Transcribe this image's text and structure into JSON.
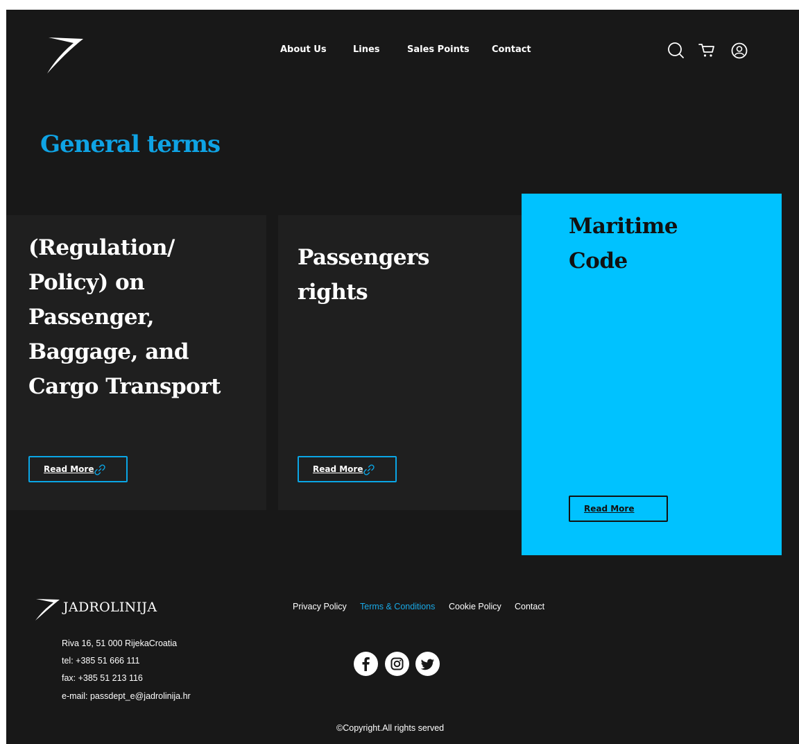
{
  "nav": {
    "items": [
      {
        "label": "About Us"
      },
      {
        "label": "Lines"
      },
      {
        "label": "Sales Points"
      },
      {
        "label": "Contact"
      }
    ],
    "icons": [
      "search-icon",
      "cart-icon",
      "user-icon"
    ]
  },
  "page": {
    "title": "General terms"
  },
  "cards": [
    {
      "title_lines": [
        "(Regulation/",
        "Policy) on",
        "Passenger,",
        "Baggage, and",
        "Cargo Transport"
      ],
      "button": "Read More",
      "icon": "link-icon"
    },
    {
      "title_lines": [
        "Passengers",
        "rights"
      ],
      "button": "Read More",
      "icon": "link-icon"
    },
    {
      "title_lines": [
        "Maritime",
        "Code"
      ],
      "button": "Read More"
    }
  ],
  "footer": {
    "brand": "JADROLINIJA",
    "address": "Riva 16, 51 000 RijekaCroatia",
    "tel": "tel: +385 51 666 111",
    "fax": "fax: +385 51 213 116",
    "email": "e-mail: passdept_e@jadrolinija.hr",
    "links": [
      {
        "label": "Privacy Policy"
      },
      {
        "label": "Terms & Conditions"
      },
      {
        "label": "Cookie Policy"
      },
      {
        "label": "Contact"
      }
    ],
    "social": [
      "facebook-icon",
      "instagram-icon",
      "twitter-icon"
    ],
    "copyright": "©Copyright.All rights served"
  },
  "colors": {
    "background": "#181818",
    "card": "#1f1f1f",
    "accent": "#00c2ff",
    "title": "#0fa3e4"
  }
}
